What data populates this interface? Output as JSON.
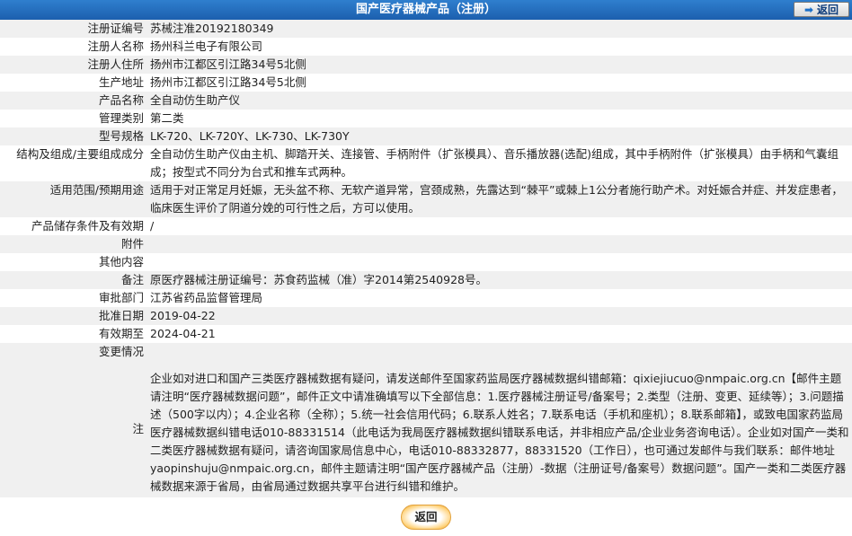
{
  "header": {
    "title": "国产医疗器械产品（注册）",
    "back_label": "返回"
  },
  "rows": [
    {
      "k": "注册证编号",
      "v": "苏械注准20192180349"
    },
    {
      "k": "注册人名称",
      "v": "扬州科兰电子有限公司"
    },
    {
      "k": "注册人住所",
      "v": "扬州市江都区引江路34号5北侧"
    },
    {
      "k": "生产地址",
      "v": "扬州市江都区引江路34号5北侧"
    },
    {
      "k": "产品名称",
      "v": "全自动仿生助产仪"
    },
    {
      "k": "管理类别",
      "v": "第二类"
    },
    {
      "k": "型号规格",
      "v": "LK-720、LK-720Y、LK-730、LK-730Y"
    },
    {
      "k": "结构及组成/主要组成成分",
      "v": "全自动仿生助产仪由主机、脚踏开关、连接管、手柄附件（扩张模具）、音乐播放器(选配)组成，其中手柄附件（扩张模具）由手柄和气囊组成；按型式不同分为台式和推车式两种。"
    },
    {
      "k": "适用范围/预期用途",
      "v": "适用于对正常足月妊娠，无头盆不称、无软产道异常，宫颈成熟，先露达到“棘平”或棘上1公分者施行助产术。对妊娠合并症、并发症患者，临床医生评价了阴道分娩的可行性之后，方可以使用。"
    },
    {
      "k": "产品储存条件及有效期",
      "v": "/"
    },
    {
      "k": "附件",
      "v": ""
    },
    {
      "k": "其他内容",
      "v": ""
    },
    {
      "k": "备注",
      "v": "原医疗器械注册证编号：苏食药监械（准）字2014第2540928号。"
    },
    {
      "k": "审批部门",
      "v": "江苏省药品监督管理局"
    },
    {
      "k": "批准日期",
      "v": "2019-04-22"
    },
    {
      "k": "有效期至",
      "v": "2024-04-21"
    },
    {
      "k": "变更情况",
      "v": ""
    }
  ],
  "note": {
    "k": "注",
    "v": "企业如对进口和国产三类医疗器械数据有疑问，请发送邮件至国家药监局医疗器械数据纠错邮箱：qixiejiucuo@nmpaic.org.cn【邮件主题请注明“医疗器械数据问题”，邮件正文中请准确填写以下全部信息：1.医疗器械注册证号/备案号；2.类型（注册、变更、延续等）；3.问题描述（500字以内）；4.企业名称（全称）；5.统一社会信用代码；6.联系人姓名；7.联系电话（手机和座机）；8.联系邮箱】，或致电国家药监局医疗器械数据纠错电话010-88331514（此电话为我局医疗器械数据纠错联系电话，并非相应产品/企业业务咨询电话）。企业如对国产一类和二类医疗器械数据有疑问，请咨询国家局信息中心，电话010-88332877，88331520（工作日），也可通过发邮件与我们联系：邮件地址yaopinshuju@nmpaic.org.cn，邮件主题请注明“国产医疗器械产品（注册）-数据（注册证号/备案号）数据问题”。国产一类和二类医疗器械数据来源于省局，由省局通过数据共享平台进行纠错和维护。"
  },
  "footer": {
    "back_label": "返回"
  }
}
